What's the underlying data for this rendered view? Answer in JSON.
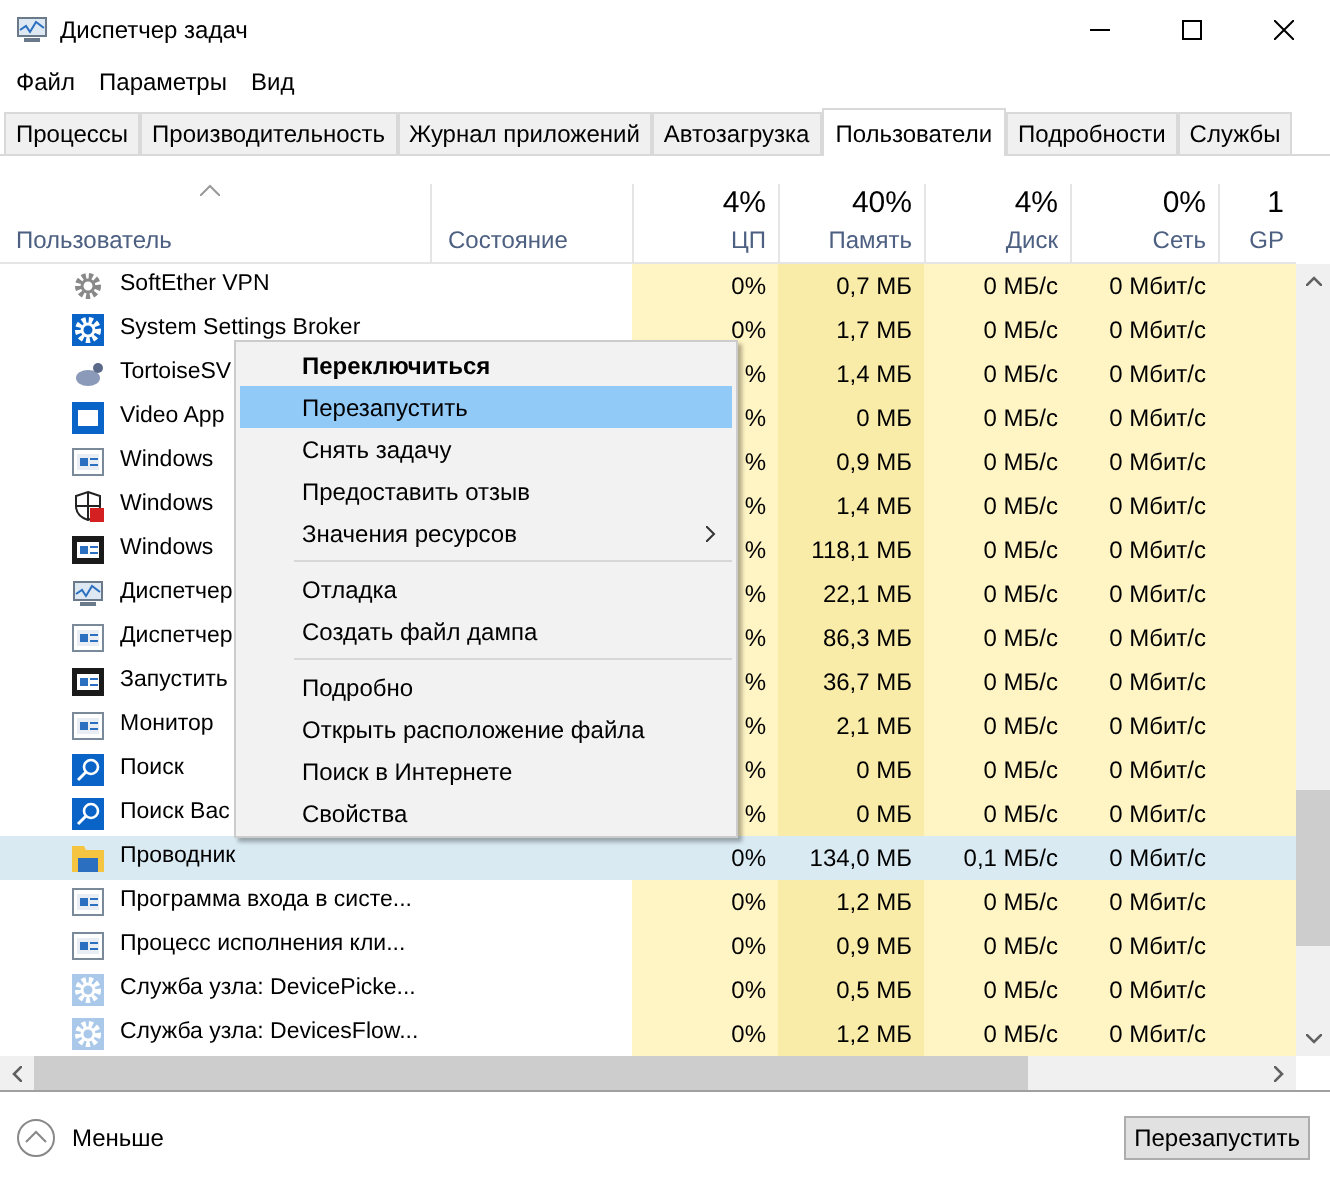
{
  "window": {
    "title": "Диспетчер задач"
  },
  "menu": [
    "Файл",
    "Параметры",
    "Вид"
  ],
  "tabs": [
    {
      "label": "Процессы",
      "selected": false
    },
    {
      "label": "Производительность",
      "selected": false
    },
    {
      "label": "Журнал приложений",
      "selected": false
    },
    {
      "label": "Автозагрузка",
      "selected": false
    },
    {
      "label": "Пользователи",
      "selected": true
    },
    {
      "label": "Подробности",
      "selected": false
    },
    {
      "label": "Службы",
      "selected": false
    }
  ],
  "columns": [
    {
      "label": "Пользователь"
    },
    {
      "label": "Состояние"
    },
    {
      "percent": "4%",
      "label": "ЦП"
    },
    {
      "percent": "40%",
      "label": "Память"
    },
    {
      "percent": "4%",
      "label": "Диск"
    },
    {
      "percent": "0%",
      "label": "Сеть"
    },
    {
      "percent": "1",
      "label": "GP"
    }
  ],
  "rows": [
    {
      "kind": "gear-grey",
      "name": "SoftEther VPN",
      "cpu": "0%",
      "memory": "0,7 МБ",
      "disk": "0 МБ/с",
      "network": "0 Мбит/с",
      "selected": false
    },
    {
      "kind": "gear-blue",
      "name": "System Settings Broker",
      "cpu": "0%",
      "memory": "1,7 МБ",
      "disk": "0 МБ/с",
      "network": "0 Мбит/с",
      "selected": false
    },
    {
      "kind": "turtle",
      "name": "TortoiseSV",
      "cpu": "%",
      "memory": "1,4 МБ",
      "disk": "0 МБ/с",
      "network": "0 Мбит/с",
      "selected": false
    },
    {
      "kind": "app",
      "name": "Video App",
      "cpu": "%",
      "memory": "0 МБ",
      "disk": "0 МБ/с",
      "network": "0 Мбит/с",
      "selected": false
    },
    {
      "kind": "window",
      "name": "Windows",
      "cpu": "%",
      "memory": "0,9 МБ",
      "disk": "0 МБ/с",
      "network": "0 Мбит/с",
      "selected": false
    },
    {
      "kind": "shield",
      "name": "Windows",
      "cpu": "%",
      "memory": "1,4 МБ",
      "disk": "0 МБ/с",
      "network": "0 Мбит/с",
      "selected": false
    },
    {
      "kind": "window-dark",
      "name": "Windows",
      "cpu": "%",
      "memory": "118,1 МБ",
      "disk": "0 МБ/с",
      "network": "0 Мбит/с",
      "selected": false
    },
    {
      "kind": "monitor",
      "name": "Диспетчер",
      "cpu": "%",
      "memory": "22,1 МБ",
      "disk": "0 МБ/с",
      "network": "0 Мбит/с",
      "selected": false
    },
    {
      "kind": "window",
      "name": "Диспетчер",
      "cpu": "%",
      "memory": "86,3 МБ",
      "disk": "0 МБ/с",
      "network": "0 Мбит/с",
      "selected": false
    },
    {
      "kind": "window-dark",
      "name": "Запустить",
      "cpu": "%",
      "memory": "36,7 МБ",
      "disk": "0 МБ/с",
      "network": "0 Мбит/с",
      "selected": false
    },
    {
      "kind": "window",
      "name": "Монитор",
      "cpu": "%",
      "memory": "2,1 МБ",
      "disk": "0 МБ/с",
      "network": "0 Мбит/с",
      "selected": false
    },
    {
      "kind": "search",
      "name": "Поиск",
      "cpu": "%",
      "memory": "0 МБ",
      "disk": "0 МБ/с",
      "network": "0 Мбит/с",
      "selected": false
    },
    {
      "kind": "search",
      "name": "Поиск Вас",
      "cpu": "%",
      "memory": "0 МБ",
      "disk": "0 МБ/с",
      "network": "0 Мбит/с",
      "selected": false
    },
    {
      "kind": "folder",
      "name": "Проводник",
      "cpu": "0%",
      "memory": "134,0 МБ",
      "disk": "0,1 МБ/с",
      "network": "0 Мбит/с",
      "selected": true
    },
    {
      "kind": "window",
      "name": "Программа входа в систе...",
      "cpu": "0%",
      "memory": "1,2 МБ",
      "disk": "0 МБ/с",
      "network": "0 Мбит/с",
      "selected": false
    },
    {
      "kind": "window",
      "name": "Процесс исполнения кли...",
      "cpu": "0%",
      "memory": "0,9 МБ",
      "disk": "0 МБ/с",
      "network": "0 Мбит/с",
      "selected": false
    },
    {
      "kind": "gear-light",
      "name": "Служба узла: DevicePicke...",
      "cpu": "0%",
      "memory": "0,5 МБ",
      "disk": "0 МБ/с",
      "network": "0 Мбит/с",
      "selected": false
    },
    {
      "kind": "gear-light",
      "name": "Служба узла: DevicesFlow...",
      "cpu": "0%",
      "memory": "1,2 МБ",
      "disk": "0 МБ/с",
      "network": "0 Мбит/с",
      "selected": false
    }
  ],
  "context_menu": [
    {
      "kind": "item",
      "label": "Переключиться",
      "bold": true,
      "selected": false,
      "submenu": false
    },
    {
      "kind": "item",
      "label": "Перезапустить",
      "bold": false,
      "selected": true,
      "submenu": false
    },
    {
      "kind": "item",
      "label": "Снять задачу",
      "bold": false,
      "selected": false,
      "submenu": false
    },
    {
      "kind": "item",
      "label": "Предоставить отзыв",
      "bold": false,
      "selected": false,
      "submenu": false
    },
    {
      "kind": "item",
      "label": "Значения ресурсов",
      "bold": false,
      "selected": false,
      "submenu": true
    },
    {
      "kind": "separator"
    },
    {
      "kind": "item",
      "label": "Отладка",
      "bold": false,
      "selected": false,
      "submenu": false
    },
    {
      "kind": "item",
      "label": "Создать файл дампа",
      "bold": false,
      "selected": false,
      "submenu": false
    },
    {
      "kind": "separator"
    },
    {
      "kind": "item",
      "label": "Подробно",
      "bold": false,
      "selected": false,
      "submenu": false
    },
    {
      "kind": "item",
      "label": "Открыть расположение файла",
      "bold": false,
      "selected": false,
      "submenu": false
    },
    {
      "kind": "item",
      "label": "Поиск в Интернете",
      "bold": false,
      "selected": false,
      "submenu": false
    },
    {
      "kind": "item",
      "label": "Свойства",
      "bold": false,
      "selected": false,
      "submenu": false
    }
  ],
  "footer": {
    "toggle": "Меньше",
    "button": "Перезапустить"
  }
}
